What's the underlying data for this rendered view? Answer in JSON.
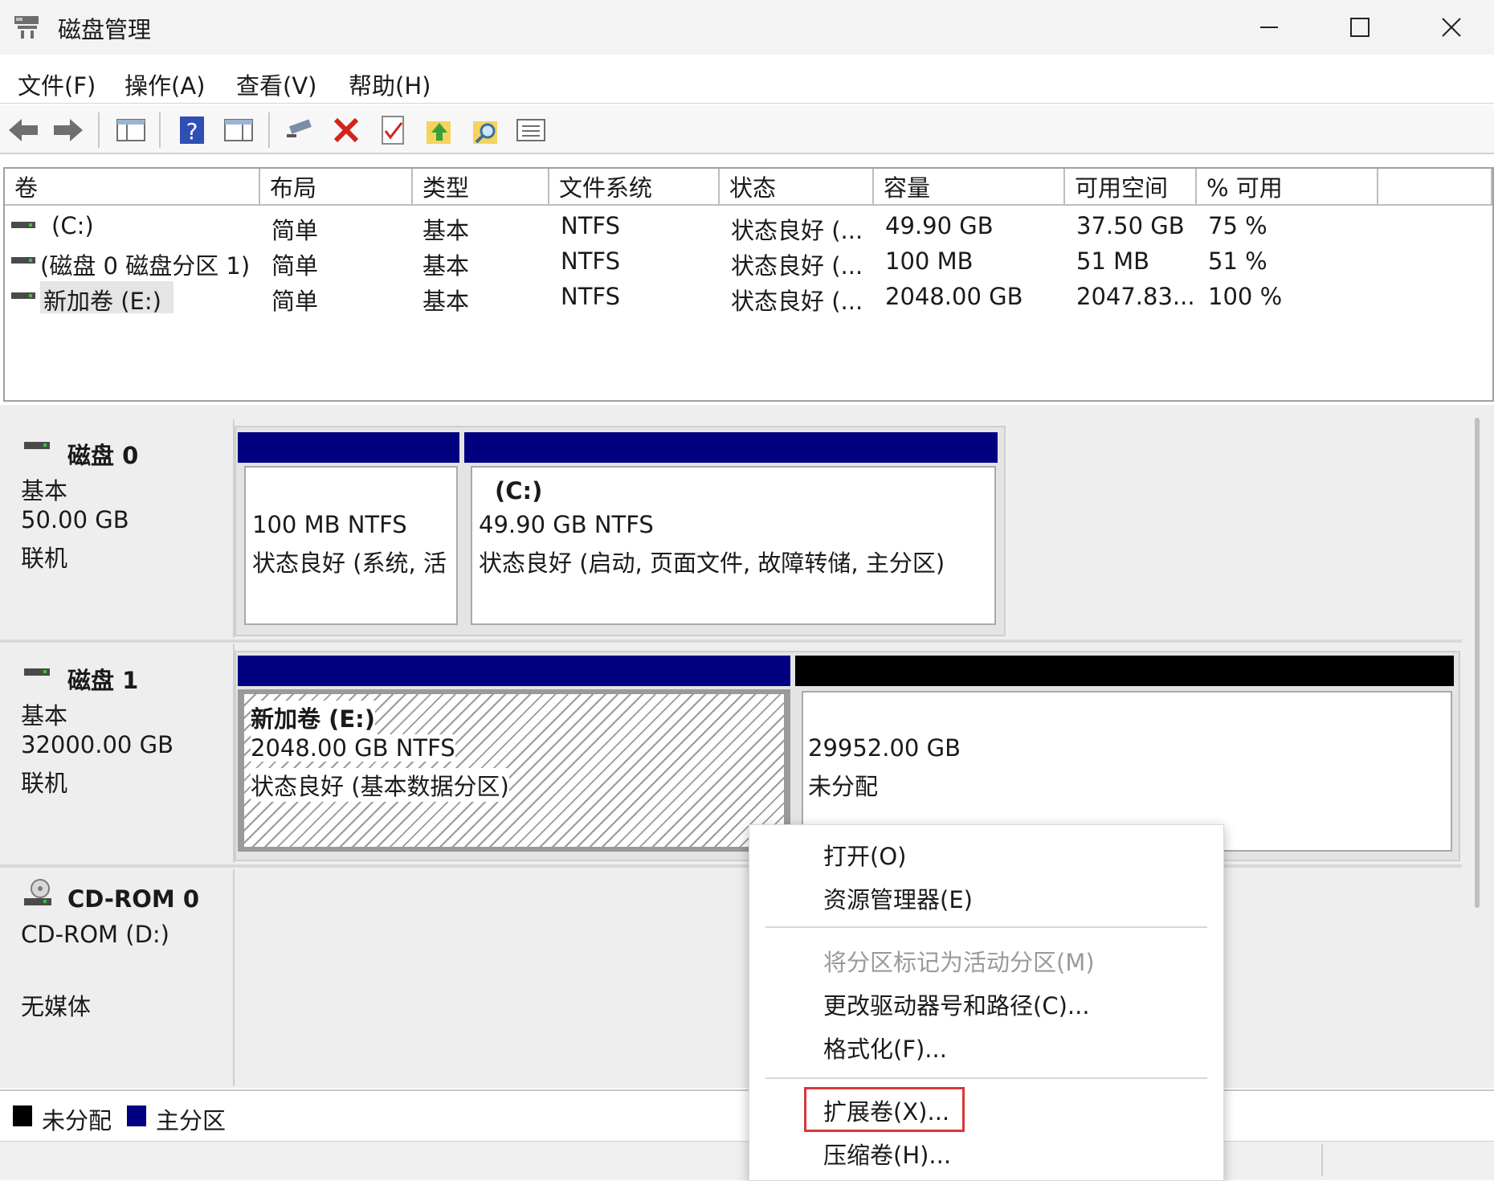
{
  "window": {
    "title": "磁盘管理",
    "minimize_icon": "minimize-icon",
    "maximize_icon": "maximize-icon",
    "close_icon": "close-icon"
  },
  "menu": [
    "文件(F)",
    "操作(A)",
    "查看(V)",
    "帮助(H)"
  ],
  "toolbar": [
    "back-arrow-icon",
    "forward-arrow-icon",
    "console-tree-icon",
    "help-icon",
    "properties-icon",
    "connect-icon",
    "delete-icon",
    "check-icon",
    "up-icon",
    "search-icon",
    "list-icon"
  ],
  "columns": [
    "卷",
    "布局",
    "类型",
    "文件系统",
    "状态",
    "容量",
    "可用空间",
    "% 可用"
  ],
  "volumes": [
    {
      "name": "(C:)",
      "layout": "简单",
      "type": "基本",
      "fs": "NTFS",
      "status": "状态良好 (...",
      "capacity": "49.90 GB",
      "free": "37.50 GB",
      "pct": "75 %"
    },
    {
      "name": "(磁盘 0 磁盘分区 1)",
      "layout": "简单",
      "type": "基本",
      "fs": "NTFS",
      "status": "状态良好 (...",
      "capacity": "100 MB",
      "free": "51 MB",
      "pct": "51 %"
    },
    {
      "name": "新加卷 (E:)",
      "layout": "简单",
      "type": "基本",
      "fs": "NTFS",
      "status": "状态良好 (...",
      "capacity": "2048.00 GB",
      "free": "2047.83...",
      "pct": "100 %"
    }
  ],
  "disks": [
    {
      "name": "磁盘 0",
      "kind": "基本",
      "size": "50.00 GB",
      "state": "联机",
      "partitions": [
        {
          "title": "",
          "line1": "100 MB NTFS",
          "line2": "状态良好 (系统, 活"
        },
        {
          "title": "(C:)",
          "line1": "49.90 GB NTFS",
          "line2": "状态良好 (启动, 页面文件, 故障转储, 主分区)"
        }
      ]
    },
    {
      "name": "磁盘 1",
      "kind": "基本",
      "size": "32000.00 GB",
      "state": "联机",
      "partitions": [
        {
          "title": "新加卷  (E:)",
          "line1": "2048.00 GB NTFS",
          "line2": "状态良好 (基本数据分区)"
        },
        {
          "title": "",
          "line1": "29952.00 GB",
          "line2": "未分配"
        }
      ]
    },
    {
      "name": "CD-ROM 0",
      "kind": "CD-ROM (D:)",
      "size": "",
      "state": "无媒体"
    }
  ],
  "legend": {
    "unallocated": "未分配",
    "primary": "主分区",
    "unallocated_color": "#000000",
    "primary_color": "#000080"
  },
  "context_menu": {
    "open": "打开(O)",
    "explore": "资源管理器(E)",
    "mark_active": "将分区标记为活动分区(M)",
    "change_letter": "更改驱动器号和路径(C)...",
    "format": "格式化(F)...",
    "extend": "扩展卷(X)...",
    "shrink": "压缩卷(H)...",
    "highlight_color": "#d9373a"
  }
}
